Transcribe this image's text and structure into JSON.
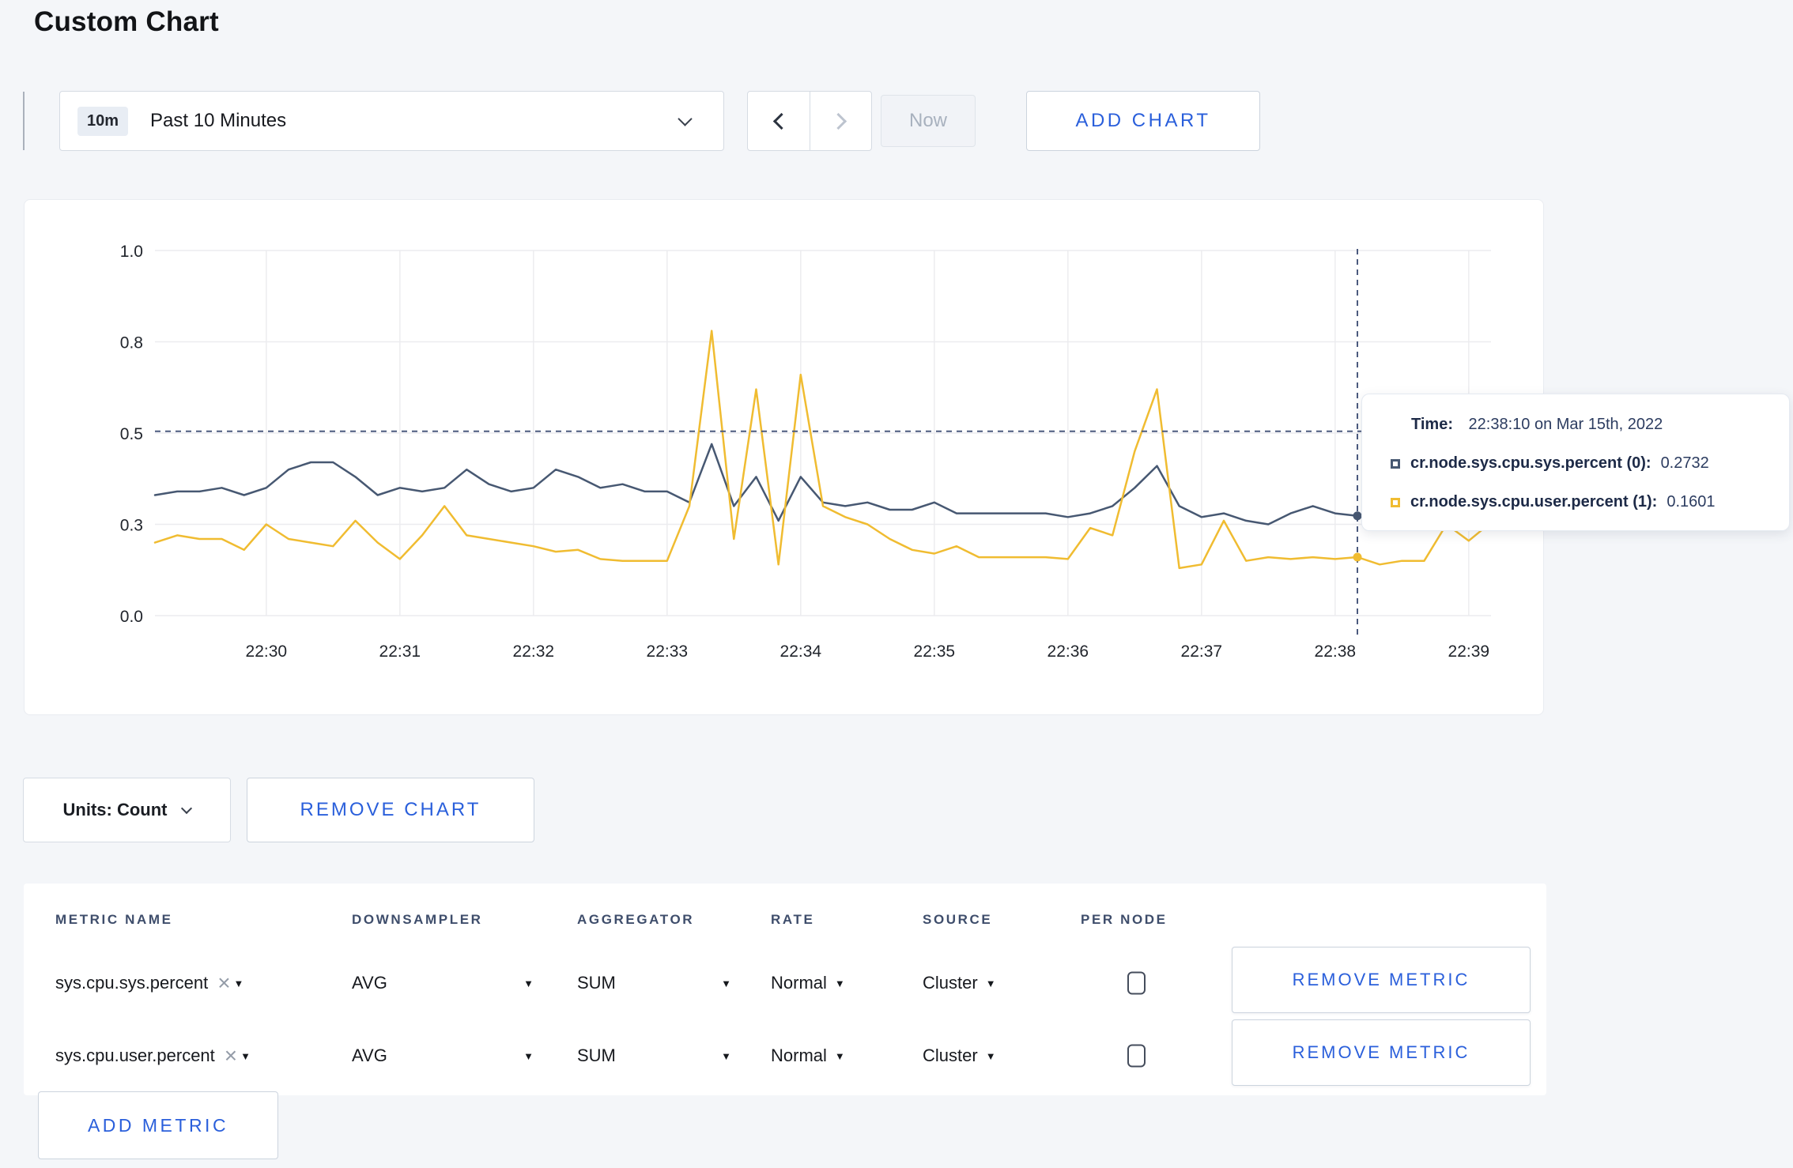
{
  "page": {
    "title": "Custom Chart"
  },
  "toolbar": {
    "time_range": {
      "badge": "10m",
      "label": "Past 10 Minutes"
    },
    "now_label": "Now",
    "add_chart_label": "ADD CHART"
  },
  "tooltip": {
    "time_label": "Time:",
    "time_value": "22:38:10 on Mar 15th, 2022",
    "series": [
      {
        "name": "cr.node.sys.cpu.sys.percent (0):",
        "value": "0.2732",
        "color": "#475872"
      },
      {
        "name": "cr.node.sys.cpu.user.percent (1):",
        "value": "0.1601",
        "color": "#f0bc31"
      }
    ]
  },
  "chart_actions": {
    "units_label": "Units: Count",
    "remove_chart_label": "REMOVE CHART"
  },
  "metrics_table": {
    "headers": [
      "METRIC NAME",
      "DOWNSAMPLER",
      "AGGREGATOR",
      "RATE",
      "SOURCE",
      "PER NODE"
    ],
    "rows": [
      {
        "metric": "sys.cpu.sys.percent",
        "downsampler": "AVG",
        "aggregator": "SUM",
        "rate": "Normal",
        "source": "Cluster",
        "per_node_checked": false,
        "remove_label": "REMOVE METRIC"
      },
      {
        "metric": "sys.cpu.user.percent",
        "downsampler": "AVG",
        "aggregator": "SUM",
        "rate": "Normal",
        "source": "Cluster",
        "per_node_checked": false,
        "remove_label": "REMOVE METRIC"
      }
    ],
    "add_metric_label": "ADD METRIC"
  },
  "chart_data": {
    "type": "line",
    "title": "",
    "x_start_time": "22:29:10",
    "sample_interval_seconds": 10,
    "x_domain_seconds": [
      0,
      600
    ],
    "ylim": [
      0,
      1
    ],
    "grid": true,
    "x_ticks": [
      {
        "t": 50,
        "label": "22:30"
      },
      {
        "t": 110,
        "label": "22:31"
      },
      {
        "t": 170,
        "label": "22:32"
      },
      {
        "t": 230,
        "label": "22:33"
      },
      {
        "t": 290,
        "label": "22:34"
      },
      {
        "t": 350,
        "label": "22:35"
      },
      {
        "t": 410,
        "label": "22:36"
      },
      {
        "t": 470,
        "label": "22:37"
      },
      {
        "t": 530,
        "label": "22:38"
      },
      {
        "t": 590,
        "label": "22:39"
      }
    ],
    "y_ticks": [
      {
        "v": 0,
        "label": "0.0"
      },
      {
        "v": 0.25,
        "label": "0.3"
      },
      {
        "v": 0.5,
        "label": "0.5"
      },
      {
        "v": 0.75,
        "label": "0.8"
      },
      {
        "v": 1,
        "label": "1.0"
      }
    ],
    "series": [
      {
        "name": "cr.node.sys.cpu.sys.percent",
        "color": "#475872",
        "values": [
          0.33,
          0.34,
          0.34,
          0.35,
          0.33,
          0.35,
          0.4,
          0.42,
          0.42,
          0.38,
          0.33,
          0.35,
          0.34,
          0.35,
          0.4,
          0.36,
          0.34,
          0.35,
          0.4,
          0.38,
          0.35,
          0.36,
          0.34,
          0.34,
          0.31,
          0.47,
          0.3,
          0.38,
          0.26,
          0.38,
          0.31,
          0.3,
          0.31,
          0.29,
          0.29,
          0.31,
          0.28,
          0.28,
          0.28,
          0.28,
          0.28,
          0.27,
          0.28,
          0.3,
          0.35,
          0.41,
          0.3,
          0.27,
          0.28,
          0.26,
          0.25,
          0.28,
          0.3,
          0.28,
          0.2732,
          0.26,
          0.27,
          0.28,
          0.27,
          0.28,
          0.28
        ]
      },
      {
        "name": "cr.node.sys.cpu.user.percent",
        "color": "#f0bc31",
        "values": [
          0.2,
          0.22,
          0.21,
          0.21,
          0.18,
          0.25,
          0.21,
          0.2,
          0.19,
          0.26,
          0.2,
          0.155,
          0.22,
          0.3,
          0.22,
          0.21,
          0.2,
          0.19,
          0.175,
          0.18,
          0.155,
          0.15,
          0.15,
          0.15,
          0.3,
          0.78,
          0.21,
          0.62,
          0.14,
          0.66,
          0.3,
          0.27,
          0.25,
          0.21,
          0.18,
          0.17,
          0.19,
          0.16,
          0.16,
          0.16,
          0.16,
          0.155,
          0.24,
          0.22,
          0.45,
          0.62,
          0.13,
          0.14,
          0.26,
          0.15,
          0.16,
          0.155,
          0.16,
          0.155,
          0.1601,
          0.14,
          0.15,
          0.15,
          0.25,
          0.205,
          0.255
        ]
      }
    ],
    "crosshair": {
      "t": 540,
      "time": "22:38:10",
      "hover_value": 0.505,
      "point_values": [
        0.2732,
        0.1601
      ]
    }
  }
}
